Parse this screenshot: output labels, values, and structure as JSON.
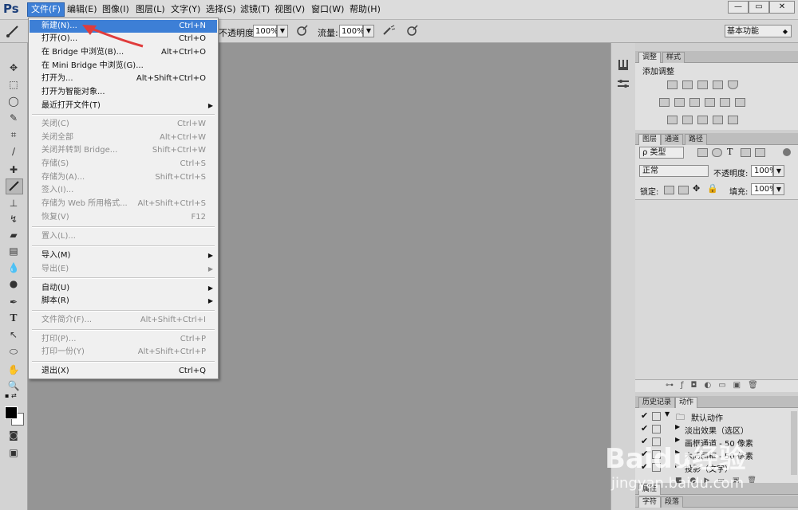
{
  "app": {
    "logo": "Ps"
  },
  "menubar": {
    "items": [
      "文件(F)",
      "编辑(E)",
      "图像(I)",
      "图层(L)",
      "文字(Y)",
      "选择(S)",
      "滤镜(T)",
      "视图(V)",
      "窗口(W)",
      "帮助(H)"
    ],
    "window_buttons": [
      "—",
      "▭",
      "✕"
    ]
  },
  "options": {
    "opacity_label": "不透明度:",
    "opacity_value": "100%",
    "flow_label": "流量:",
    "flow_value": "100%",
    "workspace": "基本功能"
  },
  "file_menu": {
    "items": [
      {
        "label": "新建(N)...",
        "shortcut": "Ctrl+N"
      },
      {
        "label": "打开(O)...",
        "shortcut": "Ctrl+O"
      },
      {
        "label": "在 Bridge 中浏览(B)...",
        "shortcut": "Alt+Ctrl+O"
      },
      {
        "label": "在 Mini Bridge 中浏览(G)...",
        "shortcut": ""
      },
      {
        "label": "打开为...",
        "shortcut": "Alt+Shift+Ctrl+O"
      },
      {
        "label": "打开为智能对象...",
        "shortcut": ""
      },
      {
        "label": "最近打开文件(T)",
        "shortcut": ""
      },
      {
        "label": "关闭(C)",
        "shortcut": "Ctrl+W"
      },
      {
        "label": "关闭全部",
        "shortcut": "Alt+Ctrl+W"
      },
      {
        "label": "关闭并转到 Bridge...",
        "shortcut": "Shift+Ctrl+W"
      },
      {
        "label": "存储(S)",
        "shortcut": "Ctrl+S"
      },
      {
        "label": "存储为(A)...",
        "shortcut": "Shift+Ctrl+S"
      },
      {
        "label": "签入(I)...",
        "shortcut": ""
      },
      {
        "label": "存储为 Web 所用格式...",
        "shortcut": "Alt+Shift+Ctrl+S"
      },
      {
        "label": "恢复(V)",
        "shortcut": "F12"
      },
      {
        "label": "置入(L)...",
        "shortcut": ""
      },
      {
        "label": "导入(M)",
        "shortcut": ""
      },
      {
        "label": "导出(E)",
        "shortcut": ""
      },
      {
        "label": "自动(U)",
        "shortcut": ""
      },
      {
        "label": "脚本(R)",
        "shortcut": ""
      },
      {
        "label": "文件简介(F)...",
        "shortcut": "Alt+Shift+Ctrl+I"
      },
      {
        "label": "打印(P)...",
        "shortcut": "Ctrl+P"
      },
      {
        "label": "打印一份(Y)",
        "shortcut": "Alt+Shift+Ctrl+P"
      },
      {
        "label": "退出(X)",
        "shortcut": "Ctrl+Q"
      }
    ]
  },
  "panels": {
    "adjust_tabs": [
      "调整",
      "样式"
    ],
    "adjust_title": "添加调整",
    "layers_tabs": [
      "图层",
      "通道",
      "路径"
    ],
    "kind_filter": "ρ 类型",
    "blend_mode": "正常",
    "opacity_label": "不透明度:",
    "opacity_value": "100%",
    "lock_label": "锁定:",
    "fill_label": "填充:",
    "fill_value": "100%",
    "actions_tabs": [
      "历史记录",
      "动作"
    ],
    "actions": [
      "默认动作",
      "淡出效果（选区）",
      "画框通道 - 50 像素",
      "木质画框 - 50 像素",
      "投影（文字）"
    ],
    "bottom_tabs_1": [
      "属性"
    ],
    "bottom_tabs_2": [
      "字符",
      "段落"
    ]
  },
  "watermark": {
    "brand": "Baidu经验",
    "url": "jingyan.baidu.com"
  },
  "colors": {
    "highlight": "#3d7fd6",
    "annotation_arrow": "#e03c3c"
  }
}
